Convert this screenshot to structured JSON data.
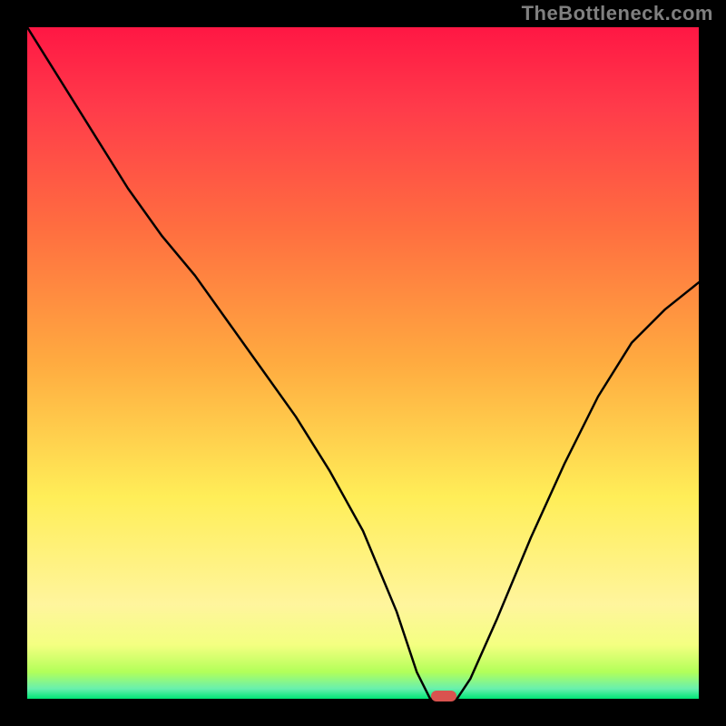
{
  "watermark": "TheBottleneck.com",
  "colors": {
    "frame_bg": "#000000",
    "watermark": "#808080",
    "curve_stroke": "#000000",
    "marker_fill": "#d9534f",
    "gradient_top": "#ff1744",
    "gradient_mid": "#ffeb3b",
    "gradient_green": "#00e676"
  },
  "chart_data": {
    "type": "line",
    "title": "",
    "xlabel": "",
    "ylabel": "",
    "xlim": [
      0,
      100
    ],
    "ylim": [
      0,
      100
    ],
    "x": [
      0,
      5,
      10,
      15,
      20,
      25,
      30,
      35,
      40,
      45,
      50,
      55,
      58,
      60,
      62,
      64,
      66,
      70,
      75,
      80,
      85,
      90,
      95,
      100
    ],
    "values": [
      100,
      92,
      84,
      76,
      69,
      63,
      56,
      49,
      42,
      34,
      25,
      13,
      4,
      0,
      0,
      0,
      3,
      12,
      24,
      35,
      45,
      53,
      58,
      62
    ],
    "marker": {
      "x": 62,
      "y": 0
    },
    "background_gradient": {
      "direction": "vertical",
      "stops": [
        {
          "pos": 0.0,
          "color": "#ff1744"
        },
        {
          "pos": 0.12,
          "color": "#ff3b4a"
        },
        {
          "pos": 0.3,
          "color": "#ff6e40"
        },
        {
          "pos": 0.5,
          "color": "#ffab40"
        },
        {
          "pos": 0.7,
          "color": "#ffee58"
        },
        {
          "pos": 0.86,
          "color": "#fff59d"
        },
        {
          "pos": 0.92,
          "color": "#f4ff81"
        },
        {
          "pos": 0.96,
          "color": "#b2ff59"
        },
        {
          "pos": 0.985,
          "color": "#69f0ae"
        },
        {
          "pos": 1.0,
          "color": "#00e676"
        }
      ]
    }
  }
}
